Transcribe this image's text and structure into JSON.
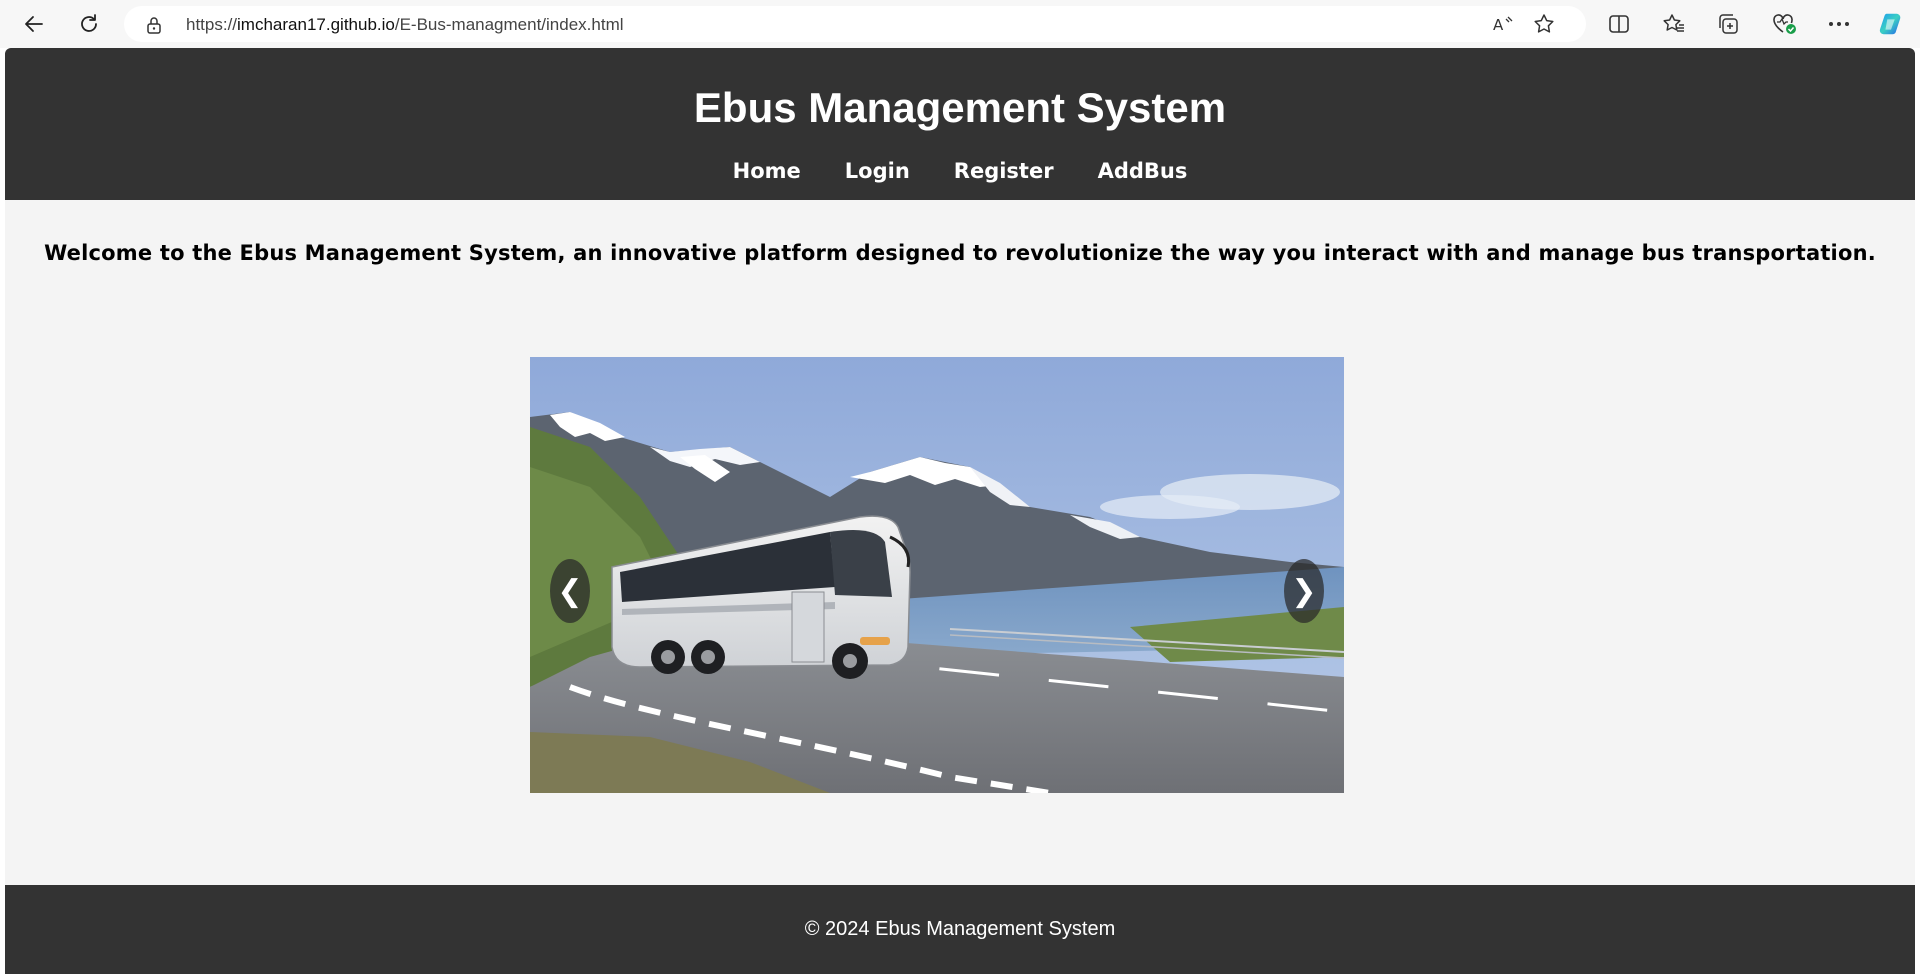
{
  "browser": {
    "url_prefix": "https://",
    "url_host": "imcharan17.github.io",
    "url_path": "/E-Bus-managment/index.html",
    "icons": [
      "back-icon",
      "refresh-icon",
      "lock-icon",
      "read-aloud-icon",
      "favorite-star-icon",
      "split-screen-icon",
      "favorites-icon",
      "collections-icon",
      "browser-essentials-icon",
      "more-icon",
      "copilot-icon"
    ]
  },
  "header": {
    "title": "Ebus Management System",
    "nav": {
      "home": "Home",
      "login": "Login",
      "register": "Register",
      "addbus": "AddBus"
    }
  },
  "main": {
    "welcome": "Welcome to the Ebus Management System, an innovative platform designed to revolutionize the way you interact with and manage bus transportation.",
    "carousel": {
      "prev_label": "❮",
      "next_label": "❯"
    }
  },
  "footer": {
    "text": "© 2024 Ebus Management System"
  },
  "colors": {
    "header_bg": "#333333",
    "page_bg": "#f4f4f4",
    "text_light": "#ffffff"
  }
}
